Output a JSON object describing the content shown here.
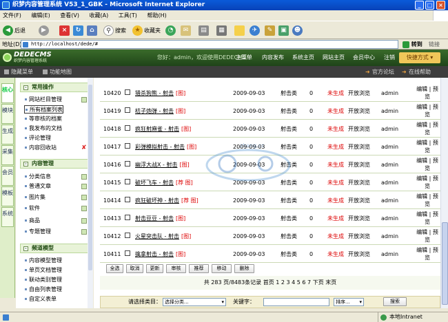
{
  "window": {
    "title": "织梦内容管理系统 V53_1_GBK - Microsoft Internet Explorer"
  },
  "menubar": [
    "文件(F)",
    "编辑(E)",
    "查看(V)",
    "收藏(A)",
    "工具(T)",
    "帮助(H)"
  ],
  "toolbar": {
    "back": "后退",
    "search": "搜索",
    "favorites": "收藏夹"
  },
  "address": {
    "label": "地址(D)",
    "url": "http://localhost/dede/#",
    "go": "转到",
    "links": "链接"
  },
  "brand": {
    "name": "DEDECMS",
    "subtitle": "织梦内容管理系统"
  },
  "header": {
    "welcome": "您好：admin，欢迎使用DEDECMS！",
    "nav": [
      "主菜单",
      "内容发布",
      "系统主页",
      "网站主页",
      "会员中心",
      "注销"
    ],
    "fast": "快捷方式"
  },
  "subheader": {
    "hide_menu": "隐藏菜单",
    "feature_map": "功能地图",
    "forum": "官方论坛",
    "help": "在线帮助"
  },
  "vtabs": [
    "核心",
    "模块",
    "生成",
    "采集",
    "会员",
    "模板",
    "系统"
  ],
  "sidebar": {
    "sections": [
      {
        "title": "常用操作",
        "items": [
          "网站栏目管理",
          "所有档案列表",
          "等审核的档案",
          "我发布的文档",
          "评论管理",
          "内容回收站"
        ]
      },
      {
        "title": "内容管理",
        "items": [
          "分类信息",
          "普通文章",
          "图片集",
          "软件",
          "商品",
          "专题管理"
        ]
      },
      {
        "title": "频道模型",
        "items": [
          "内容模型管理",
          "单页文档管理",
          "联动类别管理",
          "自由列表管理",
          "自定义表单"
        ]
      }
    ],
    "extra": "自定义表单"
  },
  "articles": [
    {
      "id": "10420",
      "title": "猎杀狗熊 - 射击",
      "tag": "[图]",
      "date": "2009-09-03",
      "cat": "射击类",
      "clicks": "0",
      "status": "未生成",
      "browse": "开放浏览",
      "author": "admin",
      "ops": "编辑 | 预览"
    },
    {
      "id": "10419",
      "title": "桔子炮弹 - 射击",
      "tag": "[图]",
      "date": "2009-09-03",
      "cat": "射击类",
      "clicks": "0",
      "status": "未生成",
      "browse": "开放浏览",
      "author": "admin",
      "ops": "编辑 | 预览"
    },
    {
      "id": "10418",
      "title": "疯狂射麻雀 - 射击",
      "tag": "[图]",
      "date": "2009-09-03",
      "cat": "射击类",
      "clicks": "0",
      "status": "未生成",
      "browse": "开放浏览",
      "author": "admin",
      "ops": "编辑 | 预览"
    },
    {
      "id": "10417",
      "title": "彩弹模拟射击 - 射击",
      "tag": "[图]",
      "date": "2009-09-03",
      "cat": "射击类",
      "clicks": "0",
      "status": "未生成",
      "browse": "开放浏览",
      "author": "admin",
      "ops": "编辑 | 预览"
    },
    {
      "id": "10416",
      "title": "幽浮大战X - 射击",
      "tag": "[图]",
      "date": "2009-09-03",
      "cat": "射击类",
      "clicks": "0",
      "status": "未生成",
      "browse": "开放浏览",
      "author": "admin",
      "ops": "编辑 | 预览"
    },
    {
      "id": "10415",
      "title": "破坏飞车 - 射击",
      "tag": "[荐 图]",
      "date": "2009-09-03",
      "cat": "射击类",
      "clicks": "0",
      "status": "未生成",
      "browse": "开放浏览",
      "author": "admin",
      "ops": "编辑 | 预览"
    },
    {
      "id": "10414",
      "title": "疯狂破坏神 - 射击",
      "tag": "[荐 图]",
      "date": "2009-09-03",
      "cat": "射击类",
      "clicks": "0",
      "status": "未生成",
      "browse": "开放浏览",
      "author": "admin",
      "ops": "编辑 | 预览"
    },
    {
      "id": "10413",
      "title": "射击豆豆 - 射击",
      "tag": "[图]",
      "date": "2009-09-03",
      "cat": "射击类",
      "clicks": "0",
      "status": "未生成",
      "browse": "开放浏览",
      "author": "admin",
      "ops": "编辑 | 预览"
    },
    {
      "id": "10412",
      "title": "火星突击队 - 射击",
      "tag": "[图]",
      "date": "2009-09-03",
      "cat": "射击类",
      "clicks": "0",
      "status": "未生成",
      "browse": "开放浏览",
      "author": "admin",
      "ops": "编辑 | 预览"
    },
    {
      "id": "10411",
      "title": "擒拿射击 - 射击",
      "tag": "[图]",
      "date": "2009-09-03",
      "cat": "射击类",
      "clicks": "0",
      "status": "未生成",
      "browse": "开放浏览",
      "author": "admin",
      "ops": "编辑 | 预览"
    }
  ],
  "actions": [
    "全选",
    "取消",
    "更新",
    "审核",
    "推荐",
    "移动",
    "删除"
  ],
  "pagination": "共 283 页/8483条记录 首页 1 2 3 4 5 6 7 下页 末页",
  "search": {
    "cat_label": "请选择类目：",
    "cat_value": "选择分类...",
    "keyword_label": "关键字：",
    "keyword_value": "",
    "sort_value": "排序...",
    "button": "搜索"
  },
  "statusbar": {
    "zone": "本地Intranet"
  },
  "watermark": {
    "text": "zhang.cc"
  },
  "colors": {
    "header": "#2b5a22",
    "accent_red": "#d00000",
    "row_border": "#cbd9b5"
  }
}
